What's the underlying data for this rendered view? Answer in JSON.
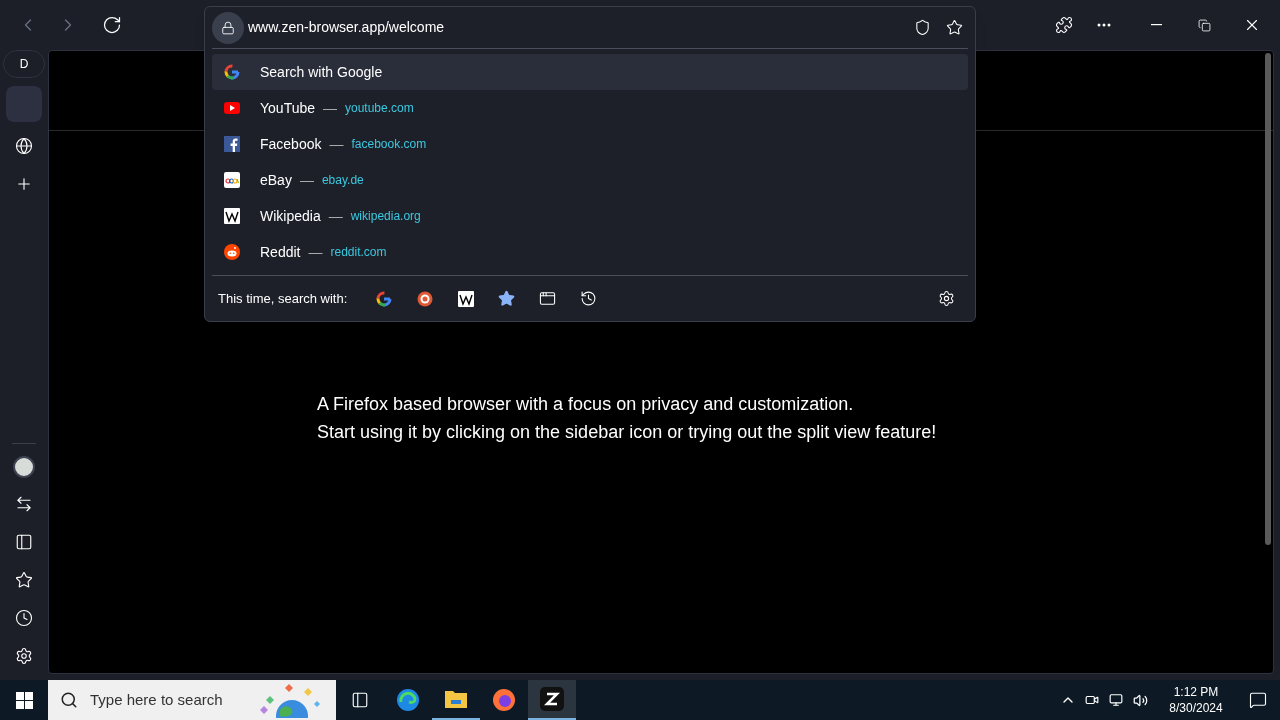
{
  "toolbar": {
    "url": "www.zen-browser.app/welcome"
  },
  "sidebar": {
    "workspace": "D"
  },
  "suggestions": [
    {
      "kind": "search",
      "title": "Search with Google",
      "selected": true
    },
    {
      "kind": "youtube",
      "title": "YouTube",
      "domain": "youtube.com",
      "selected": false
    },
    {
      "kind": "facebook",
      "title": "Facebook",
      "domain": "facebook.com",
      "selected": false
    },
    {
      "kind": "ebay",
      "title": "eBay",
      "domain": "ebay.de",
      "selected": false
    },
    {
      "kind": "wikipedia",
      "title": "Wikipedia",
      "domain": "wikipedia.org",
      "selected": false
    },
    {
      "kind": "reddit",
      "title": "Reddit",
      "domain": "reddit.com",
      "selected": false
    }
  ],
  "separator": "—",
  "search_with": {
    "label": "This time, search with:",
    "engines": [
      {
        "kind": "google"
      },
      {
        "kind": "duckduckgo"
      },
      {
        "kind": "wikipedia"
      },
      {
        "kind": "bookmarks"
      },
      {
        "kind": "tabs"
      },
      {
        "kind": "history"
      }
    ]
  },
  "page": {
    "lines": [
      "A Firefox based browser with a focus on privacy and customization.",
      "Start using it by clicking on the sidebar icon or trying out the split view feature!"
    ]
  },
  "taskbar": {
    "search_placeholder": "Type here to search",
    "time": "1:12 PM",
    "date": "8/30/2024"
  }
}
